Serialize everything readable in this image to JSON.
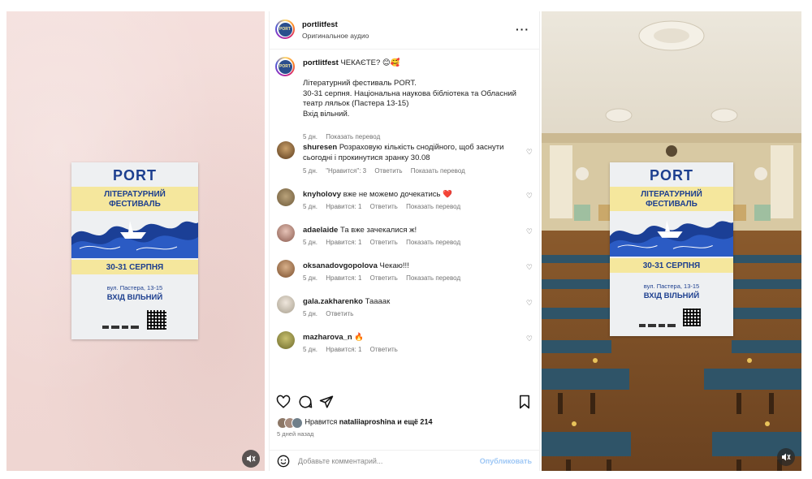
{
  "left_media": {
    "poster": {
      "logo": "PORT",
      "title_line1": "ЛІТЕРАТУРНИЙ",
      "title_line2": "ФЕСТИВАЛЬ",
      "dates": "30-31 СЕРПНЯ",
      "address": "вул. Пастера, 13-15",
      "free_entry": "ВХІД ВІЛЬНИЙ"
    }
  },
  "post": {
    "header": {
      "username": "portlitfest",
      "audio": "Оригинальное аудио"
    },
    "caption": {
      "username": "portlitfest",
      "first_line": "ЧЕКАЄТЕ? 😊🥰",
      "lines": [
        "Літературний фестиваль PORT.",
        "30-31 серпня. Національна наукова бібліотека та Обласний",
        "театр ляльок (Пастера 13-15)",
        "Вхід вільний."
      ],
      "time": "5 дн.",
      "translate": "Показать перевод"
    },
    "comments": [
      {
        "user": "shuresen",
        "text": "Розраховую кількість снодійного, щоб заснути сьогодні і прокинутися зранку 30.08",
        "time": "5 дн.",
        "likes": "\"Нравится\": 3",
        "reply": "Ответить",
        "translate": "Показать перевод"
      },
      {
        "user": "knyholovy",
        "text": "вже не можемо дочекатись ❤️",
        "time": "5 дн.",
        "likes": "Нравится: 1",
        "reply": "Ответить",
        "translate": "Показать перевод"
      },
      {
        "user": "adaelaide",
        "text": "Та вже зачекалися ж!",
        "time": "5 дн.",
        "likes": "Нравится: 1",
        "reply": "Ответить",
        "translate": "Показать перевод"
      },
      {
        "user": "oksanadovgopolova",
        "text": "Чекаю!!!",
        "time": "5 дн.",
        "likes": "Нравится: 1",
        "reply": "Ответить",
        "translate": "Показать перевод"
      },
      {
        "user": "gala.zakharenko",
        "text": "Таааак",
        "time": "5 дн.",
        "likes": "",
        "reply": "Ответить",
        "translate": ""
      },
      {
        "user": "mazharova_n",
        "text": "🔥",
        "time": "5 дн.",
        "likes": "Нравится: 1",
        "reply": "Ответить",
        "translate": ""
      }
    ],
    "likes_prefix": "Нравится",
    "likes_user": "nataliiaproshina",
    "likes_suffix": "и ещё 214",
    "date": "5 дней назад",
    "add_comment_placeholder": "Добавьте комментарий...",
    "publish_label": "Опубликовать"
  },
  "right_media": {
    "poster": {
      "logo": "PORT",
      "title_line1": "ЛІТЕРАТУРНИЙ",
      "title_line2": "ФЕСТИВАЛЬ",
      "dates": "30-31 СЕРПНЯ",
      "address": "вул. Пастера, 13-15",
      "free_entry": "ВХІД ВІЛЬНИЙ"
    }
  },
  "colors": {
    "brand_blue": "#1d3f8f",
    "poster_yellow": "#f5e79d",
    "link_blue": "#9ec7f5",
    "heart_red": "#e0245e"
  }
}
